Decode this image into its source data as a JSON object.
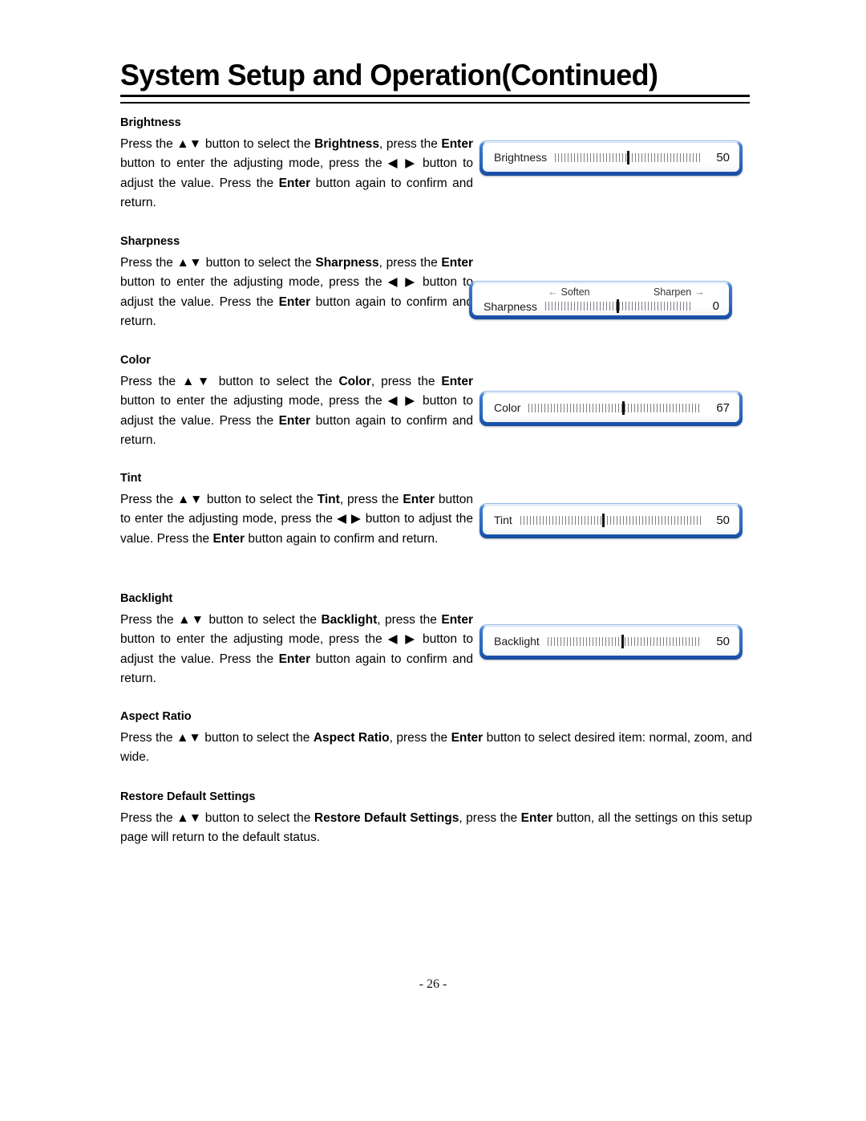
{
  "page": {
    "title": "System Setup and Operation(Continued)",
    "footer": "- 26 -"
  },
  "sections": {
    "brightness": {
      "heading": "Brightness",
      "body_parts": [
        {
          "t": "Press the ",
          "b": false
        },
        {
          "t": "▲▼",
          "b": false
        },
        {
          "t": " button to select the ",
          "b": false
        },
        {
          "t": "Brightness",
          "b": true
        },
        {
          "t": ", press the ",
          "b": false
        },
        {
          "t": "Enter",
          "b": true
        },
        {
          "t": " button to enter the adjusting mode, press the ◀ ▶ button to adjust the value. Press the ",
          "b": false
        },
        {
          "t": "Enter",
          "b": true
        },
        {
          "t": " button again to confirm and return.",
          "b": false
        }
      ]
    },
    "sharpness": {
      "heading": "Sharpness",
      "body_parts": [
        {
          "t": "Press the ",
          "b": false
        },
        {
          "t": "▲▼",
          "b": false
        },
        {
          "t": " button to select the ",
          "b": false
        },
        {
          "t": "Sharpness",
          "b": true
        },
        {
          "t": ", press the ",
          "b": false
        },
        {
          "t": "Enter",
          "b": true
        },
        {
          "t": " button to enter the adjusting mode, press the ◀ ▶ button to adjust the value. Press the ",
          "b": false
        },
        {
          "t": "Enter",
          "b": true
        },
        {
          "t": " button again to confirm and return.",
          "b": false
        }
      ]
    },
    "color": {
      "heading": "Color",
      "body_parts": [
        {
          "t": "Press the ",
          "b": false
        },
        {
          "t": "▲▼",
          "b": false
        },
        {
          "t": " button to select the ",
          "b": false
        },
        {
          "t": "Color",
          "b": true
        },
        {
          "t": ", press the ",
          "b": false
        },
        {
          "t": "Enter",
          "b": true
        },
        {
          "t": " button to enter the adjusting mode, press the ◀ ▶ button to adjust the value. Press the ",
          "b": false
        },
        {
          "t": "Enter",
          "b": true
        },
        {
          "t": " button again to confirm and return.",
          "b": false
        }
      ]
    },
    "tint": {
      "heading": "Tint",
      "body_parts": [
        {
          "t": "Press the ",
          "b": false
        },
        {
          "t": "▲▼",
          "b": false
        },
        {
          "t": " button to select the ",
          "b": false
        },
        {
          "t": "Tint",
          "b": true
        },
        {
          "t": ", press the ",
          "b": false
        },
        {
          "t": "Enter",
          "b": true
        },
        {
          "t": " button to enter the adjusting mode, press the ◀ ▶ button to adjust the value. Press the ",
          "b": false
        },
        {
          "t": "Enter",
          "b": true
        },
        {
          "t": " button again to confirm and return.",
          "b": false
        }
      ]
    },
    "backlight": {
      "heading": "Backlight",
      "body_parts": [
        {
          "t": "Press the ",
          "b": false
        },
        {
          "t": "▲▼",
          "b": false
        },
        {
          "t": " button to select the ",
          "b": false
        },
        {
          "t": "Backlight",
          "b": true
        },
        {
          "t": ", press the ",
          "b": false
        },
        {
          "t": "Enter",
          "b": true
        },
        {
          "t": " button to enter the adjusting mode, press the ◀ ▶ button to adjust the value. Press the ",
          "b": false
        },
        {
          "t": "Enter",
          "b": true
        },
        {
          "t": " button again to confirm and return.",
          "b": false
        }
      ]
    },
    "aspect_ratio": {
      "heading": "Aspect Ratio",
      "body_parts": [
        {
          "t": "Press the ",
          "b": false
        },
        {
          "t": "▲▼",
          "b": false
        },
        {
          "t": " button to select the ",
          "b": false
        },
        {
          "t": "Aspect Ratio",
          "b": true
        },
        {
          "t": ", press the ",
          "b": false
        },
        {
          "t": "Enter",
          "b": true
        },
        {
          "t": " button to select desired item: normal, zoom, and wide.",
          "b": false
        }
      ]
    },
    "restore_defaults": {
      "heading": "Restore Default Settings",
      "body_parts": [
        {
          "t": "Press the ",
          "b": false
        },
        {
          "t": "▲▼",
          "b": false
        },
        {
          "t": " button to select the ",
          "b": false
        },
        {
          "t": "Restore Default Settings",
          "b": true
        },
        {
          "t": ", press the ",
          "b": false
        },
        {
          "t": "Enter",
          "b": true
        },
        {
          "t": " button, all the settings on this setup page will return to the default status.",
          "b": false
        }
      ]
    }
  },
  "osd_boxes": {
    "brightness": {
      "label": "Brightness",
      "value": "50",
      "cursor_percent": 50
    },
    "sharpness": {
      "label": "Sharpness",
      "value": "0",
      "cursor_percent": 50,
      "hint_left": "Soften",
      "hint_right": "Sharpen",
      "hint_left_arrow": "←",
      "hint_right_arrow": "→"
    },
    "color": {
      "label": "Color",
      "value": "67",
      "cursor_percent": 55
    },
    "tint": {
      "label": "Tint",
      "value": "50",
      "cursor_percent": 46
    },
    "backlight": {
      "label": "Backlight",
      "value": "50",
      "cursor_percent": 49
    }
  },
  "colors": {
    "osd_border_blue": "#2d6cc2",
    "osd_border_blue_dark": "#174d9f",
    "osd_background": "#ffffff",
    "text": "#000000",
    "tick_gray": "#7d7d85"
  }
}
